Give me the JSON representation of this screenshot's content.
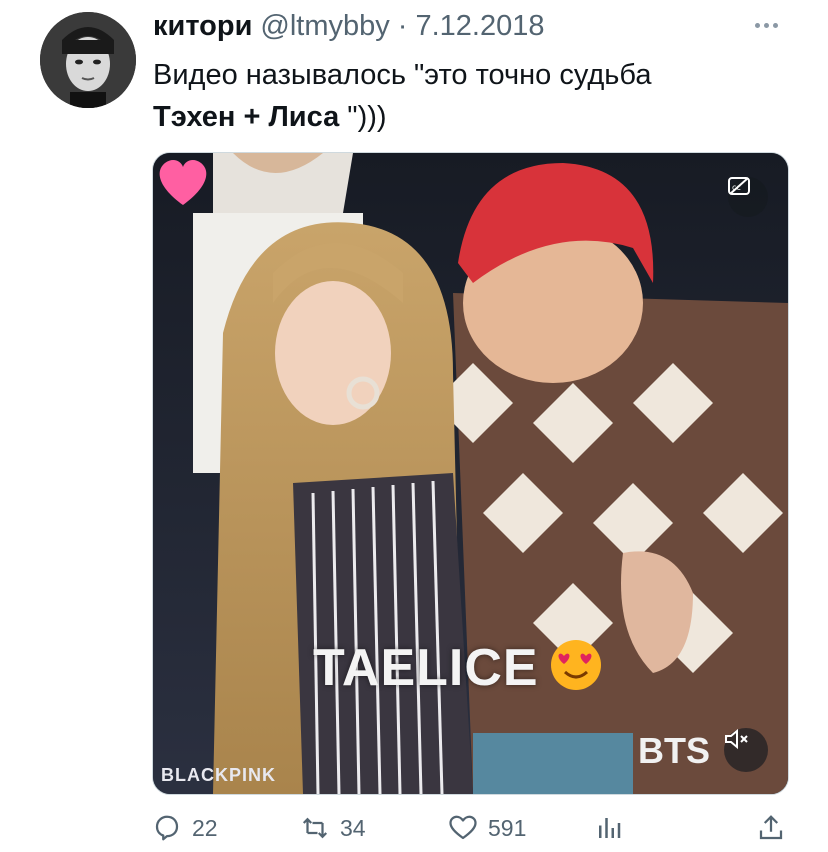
{
  "tweet": {
    "display_name": "китори",
    "handle": "@ltmybby",
    "separator": "·",
    "date": "7.12.2018",
    "text_line1": "Видео называлось \"это точно судьба",
    "text_line2_bold": "Тэхен + Лиса",
    "text_line2_rest": " \")))"
  },
  "media": {
    "overlay_title": "TAELICE",
    "watermark_left": "BLACKPINK",
    "watermark_right": "BTS"
  },
  "actions": {
    "replies": "22",
    "retweets": "34",
    "likes": "591"
  },
  "colors": {
    "text": "#0f1419",
    "secondary": "#536471",
    "hair_red": "#d8333a",
    "heart_pink": "#ff5fa2"
  }
}
